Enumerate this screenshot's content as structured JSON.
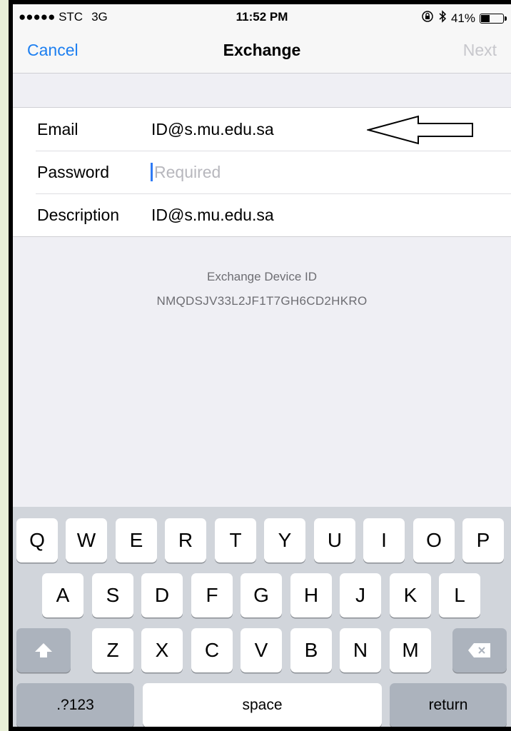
{
  "status_bar": {
    "carrier": "●●●●● STC",
    "network": "3G",
    "time": "11:52 PM",
    "battery": "41%",
    "battery_level": 0.41
  },
  "nav": {
    "cancel": "Cancel",
    "title": "Exchange",
    "next": "Next"
  },
  "form": {
    "email_label": "Email",
    "email_value": "ID@s.mu.edu.sa",
    "password_label": "Password",
    "password_placeholder": "Required",
    "description_label": "Description",
    "description_value": "ID@s.mu.edu.sa"
  },
  "device": {
    "label": "Exchange Device ID",
    "id": "NMQDSJV33L2JF1T7GH6CD2HKRO"
  },
  "keyboard": {
    "row1": [
      "Q",
      "W",
      "E",
      "R",
      "T",
      "Y",
      "U",
      "I",
      "O",
      "P"
    ],
    "row2": [
      "A",
      "S",
      "D",
      "F",
      "G",
      "H",
      "J",
      "K",
      "L"
    ],
    "row3": [
      "Z",
      "X",
      "C",
      "V",
      "B",
      "N",
      "M"
    ],
    "numbers": ".?123",
    "space": "space",
    "return": "return"
  },
  "colors": {
    "accent": "#1d7ff0",
    "disabled": "#c7c7cc",
    "frame": "#000000",
    "outer_background": "#e9f0d8"
  },
  "icons": [
    "lock-rotation-icon",
    "bluetooth-icon",
    "battery-icon",
    "shift-icon",
    "backspace-icon",
    "arrow-annotation-icon"
  ]
}
